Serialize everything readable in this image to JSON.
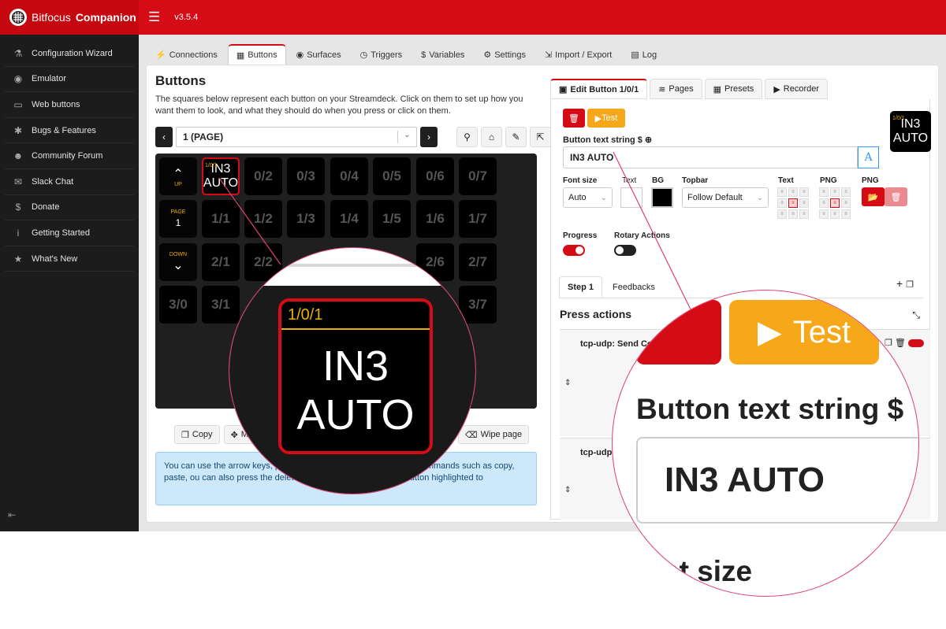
{
  "app": {
    "brand_prefix": "Bitfocus ",
    "brand_name": "Companion",
    "version": "v3.5.4"
  },
  "sidebar": {
    "items": [
      {
        "label": "Configuration Wizard",
        "icon": "wand-icon"
      },
      {
        "label": "Emulator",
        "icon": "gamepad-icon"
      },
      {
        "label": "Web buttons",
        "icon": "tablet-icon"
      },
      {
        "label": "Bugs & Features",
        "icon": "bug-icon"
      },
      {
        "label": "Community Forum",
        "icon": "users-icon"
      },
      {
        "label": "Slack Chat",
        "icon": "comments-icon"
      },
      {
        "label": "Donate",
        "icon": "dollar-icon"
      },
      {
        "label": "Getting Started",
        "icon": "info-icon"
      },
      {
        "label": "What's New",
        "icon": "star-icon"
      }
    ]
  },
  "tabs": [
    "Connections",
    "Buttons",
    "Surfaces",
    "Triggers",
    "Variables",
    "Settings",
    "Import / Export",
    "Log"
  ],
  "buttons": {
    "title": "Buttons",
    "description": "The squares below represent each button on your Streamdeck. Click on them to set up how you want them to look, and what they should do when you press or click on them.",
    "page_select": "1 (PAGE)",
    "grid": [
      [
        "",
        "0/2",
        "0/3",
        "0/4",
        "0/5",
        "0/6",
        "0/7"
      ],
      [
        "1/1",
        "1/2",
        "1/3",
        "1/4",
        "1/5",
        "1/6",
        "1/7"
      ],
      [
        "2/1",
        "2/2",
        "",
        "",
        "",
        "2/6",
        "2/7"
      ],
      [
        "3/0",
        "3/1",
        "",
        "",
        "",
        "",
        "3/7"
      ]
    ],
    "up_label": "UP",
    "page_label": "PAGE",
    "page_number": "1",
    "down_label": "DOWN",
    "selected_loc": "1/0/1",
    "selected_line1": "IN3",
    "selected_line2": "AUTO",
    "copy": "Copy",
    "move": "Mo",
    "wipe": "Wipe page",
    "info": "You can use the arrow keys, pag                                     keyboard, and use common key commands such as copy, paste,                                   ou can also press the delete or backspace key with any button highlighted to"
  },
  "editor": {
    "tabs": [
      "Edit Button 1/0/1",
      "Pages",
      "Presets",
      "Recorder"
    ],
    "test": "Test",
    "text_label": "Button text string",
    "text_value": "IN3 AUTO",
    "font_size_label": "Font size",
    "font_size": "Auto",
    "text_color_label": "Text",
    "bg_label": "BG",
    "topbar_label": "Topbar",
    "topbar_value": "Follow Default",
    "text_align_label": "Text",
    "png_align_label": "PNG",
    "png_label": "PNG",
    "progress_label": "Progress",
    "rotary_label": "Rotary Actions",
    "step_tabs": [
      "Step 1",
      "Feedbacks"
    ],
    "press_actions": "Press actions",
    "action1": "tcp-udp: Send Comm",
    "action2": "tcp-udp"
  },
  "zoom_left": {
    "loc": "1/0/1",
    "line1": "IN3",
    "line2": "AUTO"
  },
  "zoom_right": {
    "test": "Test",
    "label": "Button text string $",
    "value": "IN3 AUTO",
    "partial": "nt size"
  },
  "colors": {
    "accent": "#d50c15",
    "warning": "#f6a71a",
    "zoom_ring": "#e04070"
  }
}
